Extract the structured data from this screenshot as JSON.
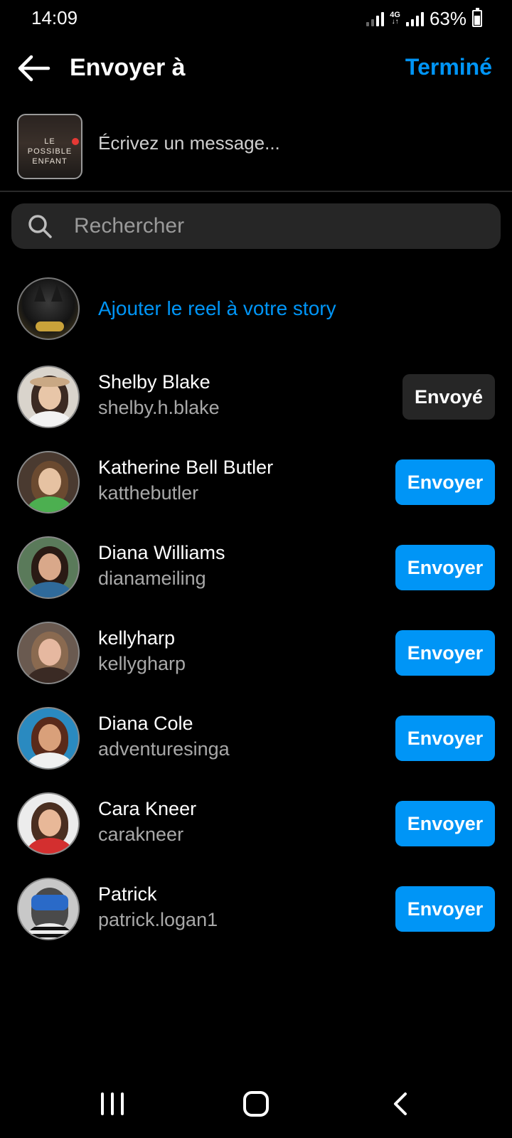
{
  "status_bar": {
    "time": "14:09",
    "network_type": "4G",
    "battery_percent": "63%",
    "battery_level": 0.63,
    "icons": [
      "signal-icon",
      "network-4g-icon",
      "signal-icon",
      "battery-icon"
    ]
  },
  "header": {
    "back_icon": "arrow-left-icon",
    "title": "Envoyer à",
    "done_label": "Terminé"
  },
  "compose": {
    "thumbnail_text": "LE POSSIBLE ENFANT",
    "message_placeholder": "Écrivez un message..."
  },
  "search": {
    "icon": "search-icon",
    "placeholder": "Rechercher"
  },
  "story": {
    "label": "Ajouter le reel à votre story"
  },
  "contacts": [
    {
      "name": "Shelby Blake",
      "username": "shelby.h.blake",
      "action": "Envoyé",
      "sent": true
    },
    {
      "name": "Katherine Bell Butler",
      "username": "katthebutler",
      "action": "Envoyer",
      "sent": false
    },
    {
      "name": "Diana Williams",
      "username": "dianameiling",
      "action": "Envoyer",
      "sent": false
    },
    {
      "name": "kellyharp",
      "username": "kellygharp",
      "action": "Envoyer",
      "sent": false
    },
    {
      "name": "Diana Cole",
      "username": "adventuresinga",
      "action": "Envoyer",
      "sent": false
    },
    {
      "name": "Cara Kneer",
      "username": "carakneer",
      "action": "Envoyer",
      "sent": false
    },
    {
      "name": "Patrick",
      "username": "patrick.logan1",
      "action": "Envoyer",
      "sent": false
    }
  ],
  "nav_bar": {
    "icons": [
      "recent-apps-icon",
      "home-icon",
      "back-icon"
    ]
  },
  "colors": {
    "accent": "#0095f6",
    "background": "#000000",
    "secondary_text": "#a8a8a8",
    "sent_button": "#262626"
  }
}
